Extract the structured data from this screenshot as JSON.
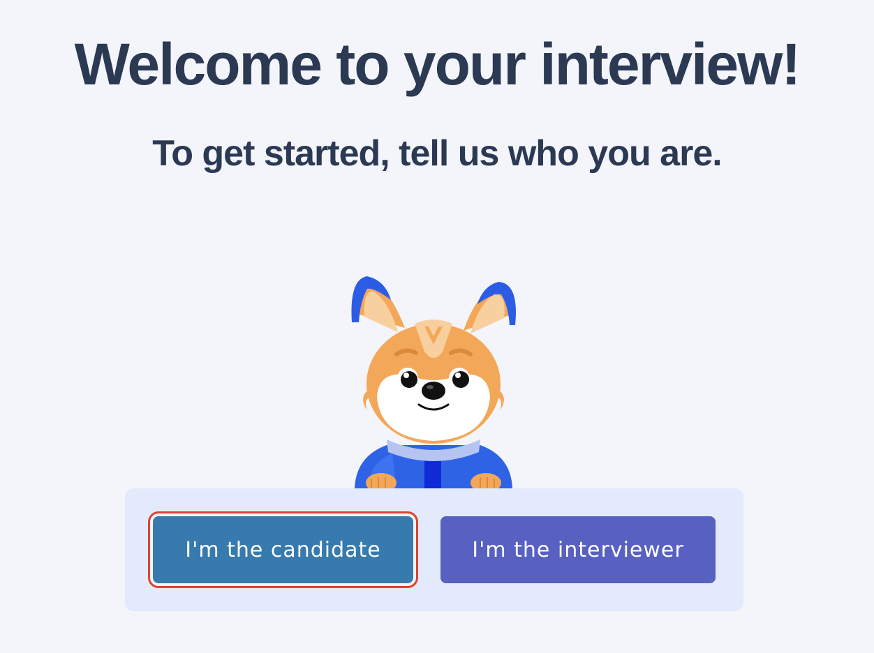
{
  "heading": {
    "title": "Welcome to your interview!",
    "subtitle": "To get started, tell us who you are."
  },
  "mascot": {
    "icon": "fox-mascot-icon"
  },
  "role_selector": {
    "candidate_label": "I'm the candidate",
    "interviewer_label": "I'm the interviewer"
  },
  "colors": {
    "background": "#f3f5fa",
    "heading_text": "#2b3953",
    "panel": "#e3eafb",
    "candidate_button": "#377aad",
    "interviewer_button": "#5860c1",
    "focus_ring": "#e0412e"
  }
}
